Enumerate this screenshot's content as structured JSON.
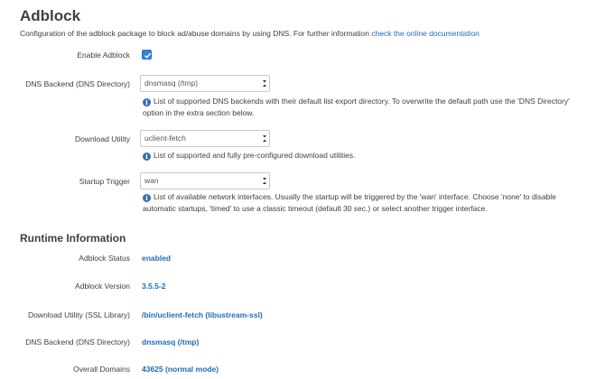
{
  "header": {
    "title": "Adblock",
    "description": "Configuration of the adblock package to block ad/abuse domains by using DNS. For further information",
    "doc_link": "check the online documentation"
  },
  "settings": {
    "enable": {
      "label": "Enable Adblock",
      "checked": true
    },
    "dns_backend": {
      "label": "DNS Backend (DNS Directory)",
      "value": "dnsmasq (/tmp)",
      "help_line1": "List of supported DNS backends with their default list export directory. To overwrite the default path use the 'DNS Directory'",
      "help_line2": "option in the extra section below."
    },
    "download_utility": {
      "label": "Download Utility",
      "value": "uclient-fetch",
      "help_line1": "List of supported and fully pre-configured download utilities."
    },
    "startup_trigger": {
      "label": "Startup Trigger",
      "value": "wan",
      "help_line1": "List of available network interfaces. Usually the startup will be triggered by the 'wan' interface. Choose 'none' to disable",
      "help_line2": "automatic startups, 'timed' to use a classic timeout (default 30 sec.) or select another trigger interface."
    }
  },
  "runtime": {
    "heading": "Runtime Information",
    "rows": [
      {
        "label": "Adblock Status",
        "value": "enabled"
      },
      {
        "label": "Adblock Version",
        "value": "3.5.5-2"
      },
      {
        "label": "Download Utility (SSL Library)",
        "value": "/bin/uclient-fetch (libustream-ssl)"
      },
      {
        "label": "DNS Backend (DNS Directory)",
        "value": "dnsmasq (/tmp)"
      },
      {
        "label": "Overall Domains",
        "value": "43625 (normal mode)"
      }
    ]
  },
  "colors": {
    "link": "#1e6bb8",
    "checkbox": "#2f83d6",
    "text": "#404040"
  },
  "icons": {
    "info": "info-circle-icon",
    "dropdown": "dropdown-arrow-icon",
    "check": "checkmark-icon"
  }
}
